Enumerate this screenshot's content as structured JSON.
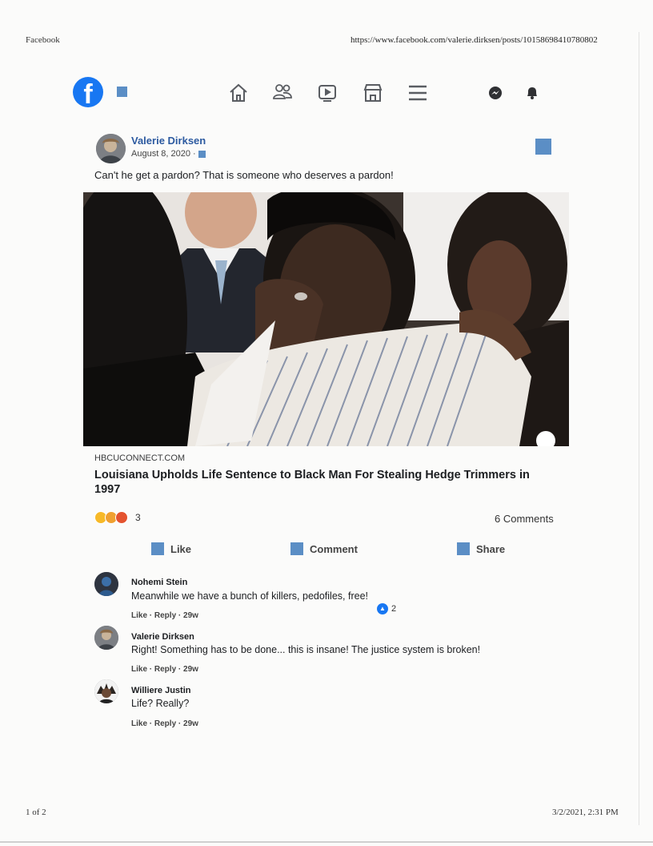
{
  "print_header": {
    "site": "Facebook",
    "url": "https://www.facebook.com/valerie.dirksen/posts/10158698410780802"
  },
  "print_footer": {
    "page": "1 of 2",
    "datetime": "3/2/2021, 2:31 PM"
  },
  "navbar": {
    "logo_letter": "f",
    "icons": [
      "home-icon",
      "friends-icon",
      "watch-icon",
      "marketplace-icon",
      "menu-icon",
      "messenger-icon",
      "notifications-icon"
    ]
  },
  "post": {
    "author": "Valerie Dirksen",
    "date": "August 8, 2020 ·",
    "text": "Can't he get a pardon?  That is someone who deserves a pardon!",
    "link": {
      "source": "HBCUCONNECT.COM",
      "title": "Louisiana Upholds Life Sentence to Black Man For Stealing Hedge Trimmers in 1997"
    },
    "reactions": {
      "emojis": [
        "care",
        "sad",
        "angry"
      ],
      "count": "3"
    },
    "comments_count": "6 Comments",
    "actions": {
      "like": "Like",
      "comment": "Comment",
      "share": "Share"
    }
  },
  "comments": [
    {
      "name": "Nohemi Stein",
      "text": "Meanwhile we have a bunch of killers, pedofiles, free!",
      "meta": "Like · Reply · 29w",
      "likes": "2"
    },
    {
      "name": "Valerie Dirksen",
      "text": "Right! Something has to be done... this is insane! The justice system is broken!",
      "meta": "Like · Reply · 29w"
    },
    {
      "name": "Williere Justin",
      "text": "Life? Really?",
      "meta": "Like · Reply · 29w"
    }
  ],
  "colors": {
    "facebook_blue": "#1877f2",
    "placeholder_square": "#5b8ec5",
    "author_link": "#2c5aa0"
  }
}
